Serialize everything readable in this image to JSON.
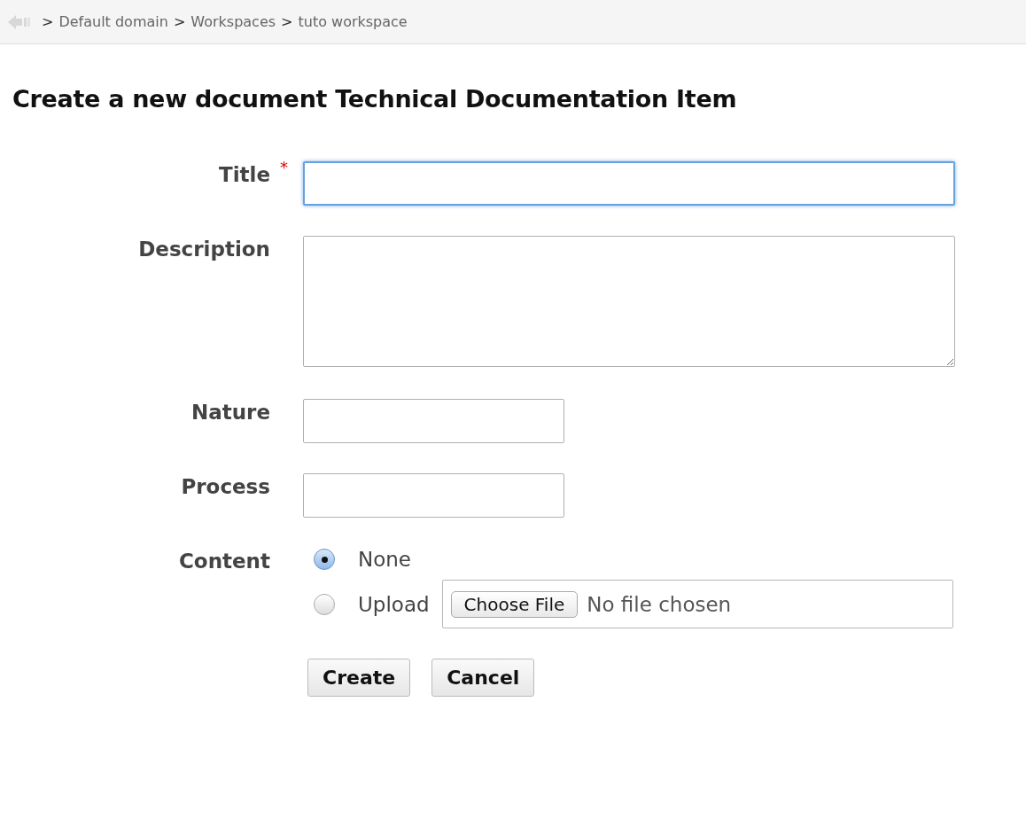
{
  "breadcrumb": [
    {
      "separator": ">",
      "label": "Default domain"
    },
    {
      "separator": ">",
      "label": "Workspaces"
    },
    {
      "separator": ">",
      "label": "tuto workspace"
    }
  ],
  "heading": "Create a new document Technical Documentation Item",
  "fields": [
    {
      "kind": "wide",
      "label": "Title",
      "required_mark": "*",
      "focused": true
    },
    {
      "kind": "textarea",
      "label": "Description",
      "focused": false
    },
    {
      "kind": "short",
      "label": "Nature",
      "focused": false
    },
    {
      "kind": "short",
      "label": "Process",
      "focused": false
    },
    {
      "kind": "radio",
      "label": "Content",
      "options": [
        {
          "label": "None",
          "selected": true
        },
        {
          "label": "Upload",
          "selected": false,
          "file_button": "Choose File",
          "file_status": "No file chosen"
        }
      ]
    }
  ],
  "buttons": [
    "Create",
    "Cancel"
  ]
}
